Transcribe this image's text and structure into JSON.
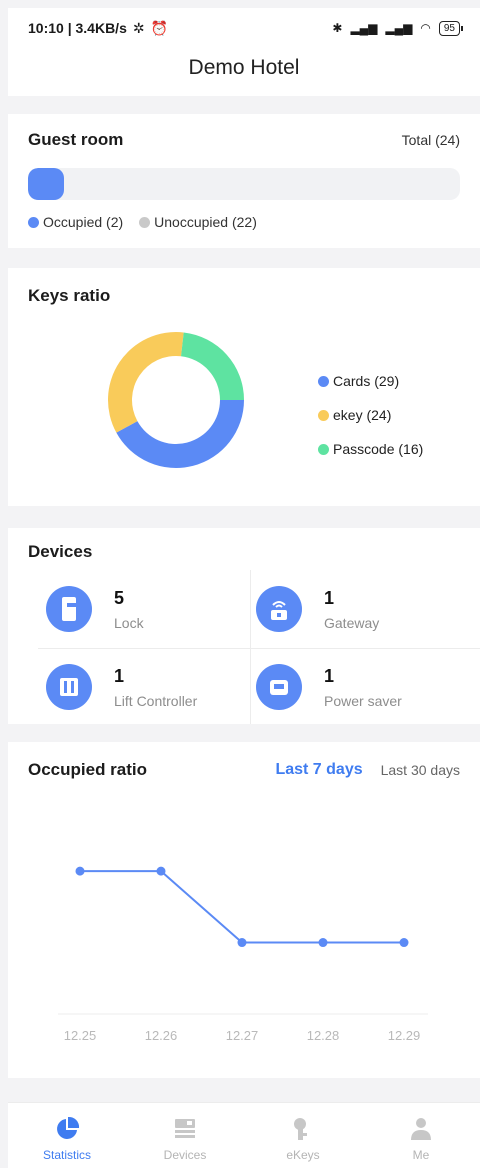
{
  "status_bar": {
    "time_speed": "10:10 | 3.4KB/s",
    "battery": "95"
  },
  "header": {
    "title": "Demo Hotel"
  },
  "guest_room": {
    "title": "Guest room",
    "total": "Total (24)",
    "occupied_fraction": 0.083,
    "legend": [
      {
        "label": "Occupied (2)",
        "color": "#5b8af5"
      },
      {
        "label": "Unoccupied (22)",
        "color": "#c9c9c9"
      }
    ]
  },
  "keys_ratio": {
    "title": "Keys ratio",
    "legend": [
      {
        "label": "Cards (29)",
        "value": 29,
        "color": "#5b8af5"
      },
      {
        "label": "ekey (24)",
        "value": 24,
        "color": "#f9cb5a"
      },
      {
        "label": "Passcode (16)",
        "value": 16,
        "color": "#5ee3a1"
      }
    ]
  },
  "devices": {
    "title": "Devices",
    "items": [
      {
        "count": "5",
        "label": "Lock",
        "icon": "lock-icon"
      },
      {
        "count": "1",
        "label": "Gateway",
        "icon": "gateway-icon"
      },
      {
        "count": "1",
        "label": "Lift Controller",
        "icon": "lift-controller-icon"
      },
      {
        "count": "1",
        "label": "Power saver",
        "icon": "power-saver-icon"
      }
    ]
  },
  "occupied_ratio": {
    "title": "Occupied ratio",
    "range_active": "Last 7 days",
    "range_other": "Last 30 days"
  },
  "chart_data": {
    "type": "line",
    "title": "Occupied ratio",
    "x": [
      "12.25",
      "12.26",
      "12.27",
      "12.28",
      "12.29"
    ],
    "series": [
      {
        "values": [
          2,
          2,
          1,
          1,
          1
        ]
      }
    ],
    "ylim": [
      0,
      2.5
    ],
    "grid": false,
    "color": "#5b8af5"
  },
  "nav": {
    "tabs": [
      {
        "label": "Statistics",
        "icon": "pie-chart-icon",
        "active": true
      },
      {
        "label": "Devices",
        "icon": "devices-icon",
        "active": false
      },
      {
        "label": "eKeys",
        "icon": "key-icon",
        "active": false
      },
      {
        "label": "Me",
        "icon": "person-icon",
        "active": false
      }
    ]
  }
}
